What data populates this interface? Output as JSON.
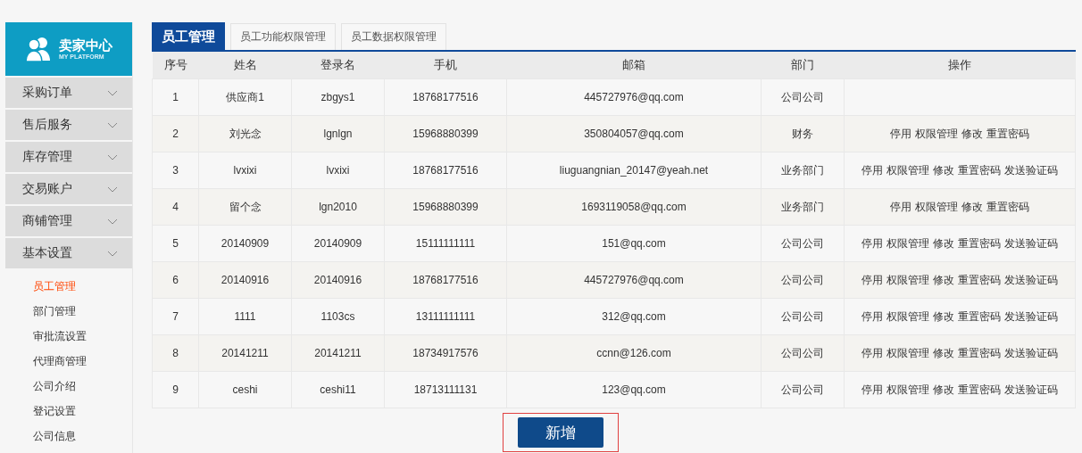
{
  "sidebar": {
    "logo": {
      "title": "卖家中心",
      "subtitle": "MY PLATFORM"
    },
    "items": [
      {
        "label": "采购订单"
      },
      {
        "label": "售后服务"
      },
      {
        "label": "库存管理"
      },
      {
        "label": "交易账户"
      },
      {
        "label": "商铺管理"
      },
      {
        "label": "基本设置",
        "children": [
          {
            "label": "员工管理",
            "selected": true
          },
          {
            "label": "部门管理",
            "selected": false
          },
          {
            "label": "审批流设置",
            "selected": false
          },
          {
            "label": "代理商管理",
            "selected": false
          },
          {
            "label": "公司介绍",
            "selected": false
          },
          {
            "label": "登记设置",
            "selected": false
          },
          {
            "label": "公司信息",
            "selected": false
          }
        ]
      }
    ]
  },
  "tabs": [
    {
      "label": "员工管理",
      "selected": true
    },
    {
      "label": "员工功能权限管理",
      "selected": false
    },
    {
      "label": "员工数据权限管理",
      "selected": false
    }
  ],
  "table": {
    "columns": [
      "序号",
      "姓名",
      "登录名",
      "手机",
      "邮箱",
      "部门",
      "操作"
    ],
    "rows": [
      {
        "cells": [
          "1",
          "供应商1",
          "zbgys1",
          "18768177516",
          "445727976@qq.com",
          "公司公司"
        ]
      },
      {
        "cells": [
          "2",
          "刘光念",
          "lgnlgn",
          "15968880399",
          "350804057@qq.com",
          "财务"
        ],
        "actions": [
          "停用",
          "权限管理",
          "修改",
          "重置密码"
        ]
      },
      {
        "cells": [
          "3",
          "lvxixi",
          "lvxixi",
          "18768177516",
          "liuguangnian_20147@yeah.net",
          "业务部门"
        ],
        "actions": [
          "停用",
          "权限管理",
          "修改",
          "重置密码",
          "发送验证码"
        ]
      },
      {
        "cells": [
          "4",
          "留个念",
          "lgn2010",
          "15968880399",
          "1693119058@qq.com",
          "业务部门"
        ],
        "actions": [
          "停用",
          "权限管理",
          "修改",
          "重置密码"
        ]
      },
      {
        "cells": [
          "5",
          "20140909",
          "20140909",
          "15111111111",
          "151@qq.com",
          "公司公司"
        ],
        "actions": [
          "停用",
          "权限管理",
          "修改",
          "重置密码",
          "发送验证码"
        ]
      },
      {
        "cells": [
          "6",
          "20140916",
          "20140916",
          "18768177516",
          "445727976@qq.com",
          "公司公司"
        ],
        "actions": [
          "停用",
          "权限管理",
          "修改",
          "重置密码",
          "发送验证码"
        ]
      },
      {
        "cells": [
          "7",
          "1111",
          "1103cs",
          "13111111111",
          "312@qq.com",
          "公司公司"
        ],
        "actions": [
          "停用",
          "权限管理",
          "修改",
          "重置密码",
          "发送验证码"
        ]
      },
      {
        "cells": [
          "8",
          "20141211",
          "20141211",
          "18734917576",
          "ccnn@126.com",
          "公司公司"
        ],
        "actions": [
          "停用",
          "权限管理",
          "修改",
          "重置密码",
          "发送验证码"
        ]
      },
      {
        "cells": [
          "9",
          "ceshi",
          "ceshi11",
          "18713111131",
          "123@qq.com",
          "公司公司"
        ],
        "actions": [
          "停用",
          "权限管理",
          "修改",
          "重置密码",
          "发送验证码"
        ]
      }
    ]
  },
  "add_button": {
    "label": "新增"
  }
}
